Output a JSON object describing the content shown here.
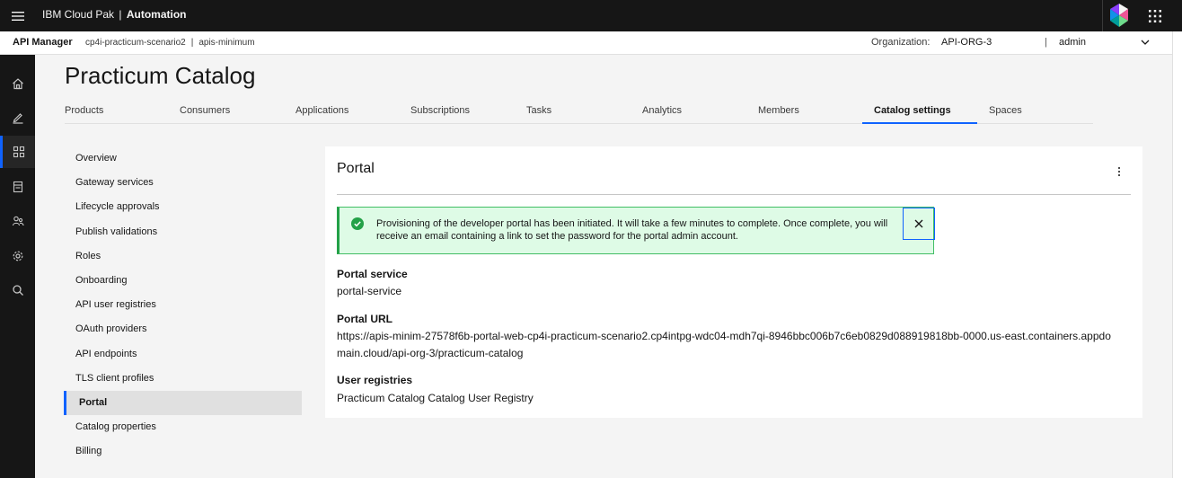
{
  "topbar": {
    "brand_prefix": "IBM Cloud Pak",
    "brand_separator": "|",
    "brand_product": "Automation",
    "icons": [
      "hamburger-menu-icon",
      "cloud-pak-logo",
      "app-switcher-icon"
    ]
  },
  "subheader": {
    "app_name": "API Manager",
    "crumb_1": "cp4i-practicum-scenario2",
    "crumb_sep": "|",
    "crumb_2": "apis-minimum",
    "org_label": "Organization:",
    "org_value": "API-ORG-3",
    "user_sep": "|",
    "user_name": "admin"
  },
  "rail": {
    "items": [
      "home-icon",
      "edit-icon",
      "dashboard-icon",
      "catalog-icon",
      "members-icon",
      "settings-icon",
      "search-icon"
    ],
    "active_index": 2
  },
  "page": {
    "title": "Practicum Catalog"
  },
  "tabs": [
    {
      "label": "Products"
    },
    {
      "label": "Consumers"
    },
    {
      "label": "Applications"
    },
    {
      "label": "Subscriptions"
    },
    {
      "label": "Tasks"
    },
    {
      "label": "Analytics"
    },
    {
      "label": "Members"
    },
    {
      "label": "Catalog settings"
    },
    {
      "label": "Spaces"
    }
  ],
  "active_tab": "Catalog settings",
  "sidenav": {
    "items": [
      {
        "label": "Overview"
      },
      {
        "label": "Gateway services"
      },
      {
        "label": "Lifecycle approvals"
      },
      {
        "label": "Publish validations"
      },
      {
        "label": "Roles"
      },
      {
        "label": "Onboarding"
      },
      {
        "label": "API user registries"
      },
      {
        "label": "OAuth providers"
      },
      {
        "label": "API endpoints"
      },
      {
        "label": "TLS client profiles"
      },
      {
        "label": "Portal"
      },
      {
        "label": "Catalog properties"
      },
      {
        "label": "Billing"
      }
    ],
    "active": "Portal"
  },
  "panel": {
    "title": "Portal",
    "notification": {
      "status": "success",
      "text": "Provisioning of the developer portal has been initiated. It will take a few minutes to complete. Once complete, you will receive an email containing a link to set the password for the portal admin account."
    },
    "fields": [
      {
        "label": "Portal service",
        "value": "portal-service"
      },
      {
        "label": "Portal URL",
        "value": "https://apis-minim-27578f6b-portal-web-cp4i-practicum-scenario2.cp4intpg-wdc04-mdh7qi-8946bbc006b7c6eb0829d088919818bb-0000.us-east.containers.appdomain.cloud/api-org-3/practicum-catalog"
      },
      {
        "label": "User registries",
        "value": "Practicum Catalog Catalog User Registry"
      }
    ]
  },
  "colors": {
    "accent": "#0f62fe",
    "success": "#24a148",
    "success_bg": "#defbe6",
    "shell": "#161616"
  }
}
